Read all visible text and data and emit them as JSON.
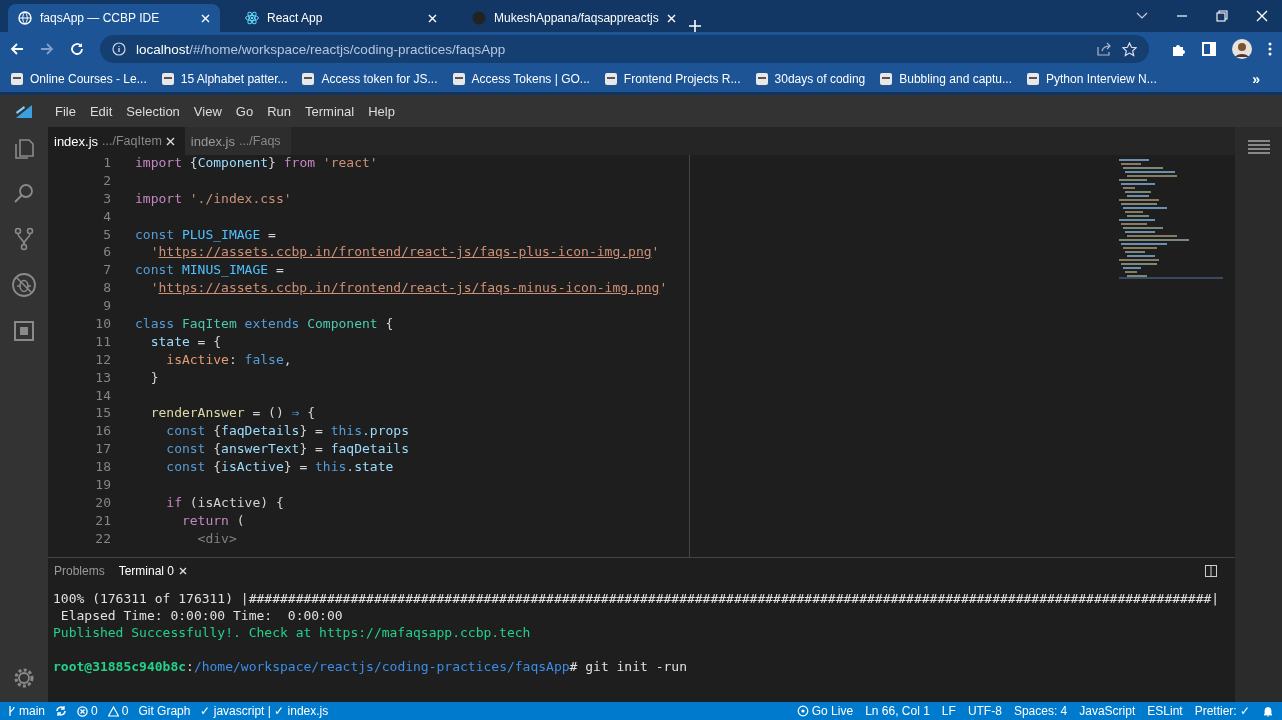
{
  "browser": {
    "tabs": [
      {
        "title": "faqsApp — CCBP IDE",
        "selected": true
      },
      {
        "title": "React App",
        "selected": false
      },
      {
        "title": "MukeshAppana/faqsappreactjs",
        "selected": false
      }
    ],
    "address": {
      "host": "localhost",
      "path": "/#/home/workspace/reactjs/coding-practices/faqsApp"
    },
    "bookmarks": [
      "Online Courses - Le...",
      "15 Alphabet patter...",
      "Access token for JS...",
      "Access Tokens | GO...",
      "Frontend Projects R...",
      "30days of coding",
      "Bubbling and captu...",
      "Python Interview N..."
    ],
    "bookmarks_more": "»"
  },
  "ide": {
    "menu": [
      "File",
      "Edit",
      "Selection",
      "View",
      "Go",
      "Run",
      "Terminal",
      "Help"
    ],
    "editor_tabs": [
      {
        "name": "index.js",
        "path": ".../FaqItem",
        "selected": true
      },
      {
        "name": "index.js",
        "path": ".../Faqs",
        "selected": false
      }
    ],
    "code": [
      {
        "number": "1",
        "tokens": [
          {
            "text": "import",
            "kind": "keyword"
          },
          {
            "text": " {",
            "kind": "plain"
          },
          {
            "text": "Component",
            "kind": "variable"
          },
          {
            "text": "} ",
            "kind": "plain"
          },
          {
            "text": "from",
            "kind": "keyword"
          },
          {
            "text": " 'react'",
            "kind": "string"
          }
        ]
      },
      {
        "number": "2"
      },
      {
        "number": "3",
        "tokens": [
          {
            "text": "import",
            "kind": "keyword"
          },
          {
            "text": " './index.css'",
            "kind": "string"
          }
        ]
      },
      {
        "number": "4"
      },
      {
        "number": "5",
        "tokens": [
          {
            "text": "const",
            "kind": "storage"
          },
          {
            "text": " PLUS_IMAGE",
            "kind": "constant"
          },
          {
            "text": " =",
            "kind": "plain"
          }
        ]
      },
      {
        "number": "6",
        "tokens": [
          {
            "text": "  '",
            "kind": "string"
          },
          {
            "text": "https://assets.ccbp.in/frontend/react-js/faqs-plus-icon-img.png",
            "kind": "url"
          },
          {
            "text": "'",
            "kind": "string"
          }
        ]
      },
      {
        "number": "7",
        "tokens": [
          {
            "text": "const",
            "kind": "storage"
          },
          {
            "text": " MINUS_IMAGE",
            "kind": "constant"
          },
          {
            "text": " =",
            "kind": "plain"
          }
        ]
      },
      {
        "number": "8",
        "tokens": [
          {
            "text": "  '",
            "kind": "string"
          },
          {
            "text": "https://assets.ccbp.in/frontend/react-js/faqs-minus-icon-img.png",
            "kind": "url"
          },
          {
            "text": "'",
            "kind": "string"
          }
        ]
      },
      {
        "number": "9"
      },
      {
        "number": "10",
        "tokens": [
          {
            "text": "class",
            "kind": "storage"
          },
          {
            "text": " FaqItem",
            "kind": "class"
          },
          {
            "text": " extends",
            "kind": "storage"
          },
          {
            "text": " Component",
            "kind": "class"
          },
          {
            "text": " {",
            "kind": "plain"
          }
        ]
      },
      {
        "number": "11",
        "tokens": [
          {
            "text": "  state",
            "kind": "variable"
          },
          {
            "text": " = {",
            "kind": "plain"
          }
        ]
      },
      {
        "number": "12",
        "tokens": [
          {
            "text": "    isActive",
            "kind": "key"
          },
          {
            "text": ": ",
            "kind": "plain"
          },
          {
            "text": "false",
            "kind": "storage"
          },
          {
            "text": ",",
            "kind": "plain"
          }
        ]
      },
      {
        "number": "13",
        "tokens": [
          {
            "text": "  }",
            "kind": "plain"
          }
        ]
      },
      {
        "number": "14"
      },
      {
        "number": "15",
        "tokens": [
          {
            "text": "  renderAnswer",
            "kind": "function"
          },
          {
            "text": " = () ",
            "kind": "plain"
          },
          {
            "text": "⇒",
            "kind": "storage"
          },
          {
            "text": " {",
            "kind": "plain"
          }
        ]
      },
      {
        "number": "16",
        "tokens": [
          {
            "text": "    const",
            "kind": "storage"
          },
          {
            "text": " {",
            "kind": "plain"
          },
          {
            "text": "faqDetails",
            "kind": "variable"
          },
          {
            "text": "} = ",
            "kind": "plain"
          },
          {
            "text": "this",
            "kind": "storage"
          },
          {
            "text": ".props",
            "kind": "variable"
          }
        ]
      },
      {
        "number": "17",
        "tokens": [
          {
            "text": "    const",
            "kind": "storage"
          },
          {
            "text": " {",
            "kind": "plain"
          },
          {
            "text": "answerText",
            "kind": "variable"
          },
          {
            "text": "} = ",
            "kind": "plain"
          },
          {
            "text": "faqDetails",
            "kind": "variable"
          }
        ]
      },
      {
        "number": "18",
        "tokens": [
          {
            "text": "    const",
            "kind": "storage"
          },
          {
            "text": " {",
            "kind": "plain"
          },
          {
            "text": "isActive",
            "kind": "variable"
          },
          {
            "text": "} = ",
            "kind": "plain"
          },
          {
            "text": "this",
            "kind": "storage"
          },
          {
            "text": ".state",
            "kind": "variable"
          }
        ]
      },
      {
        "number": "19"
      },
      {
        "number": "20",
        "tokens": [
          {
            "text": "    if",
            "kind": "keyword"
          },
          {
            "text": " (isActive) {",
            "kind": "plain"
          }
        ]
      },
      {
        "number": "21",
        "tokens": [
          {
            "text": "      return",
            "kind": "keyword"
          },
          {
            "text": " (",
            "kind": "plain"
          }
        ]
      },
      {
        "number": "22",
        "tokens": [
          {
            "text": "        <",
            "kind": "tag"
          },
          {
            "text": "div",
            "kind": "tag"
          },
          {
            "text": ">",
            "kind": "tag"
          }
        ]
      }
    ],
    "panel_tabs": [
      {
        "label": "Problems",
        "selected": false
      },
      {
        "label": "Terminal 0",
        "selected": true
      }
    ],
    "terminal": [
      {
        "segments": [
          {
            "text": "100% (176311 of 176311) |###########################################################################################################################|",
            "kind": "plain"
          }
        ]
      },
      {
        "segments": [
          {
            "text": " Elapsed Time: 0:00:00 Time:  0:00:00",
            "kind": "plain"
          }
        ]
      },
      {
        "segments": [
          {
            "text": "Published Successfully!. Check at https://mafaqsapp.ccbp.tech",
            "kind": "success"
          }
        ]
      },
      {
        "segments": [
          {
            "text": "root@31885c940b8c",
            "kind": "user"
          },
          {
            "text": ":",
            "kind": "plain"
          },
          {
            "text": "/home/workspace/reactjs/coding-practices/faqsApp",
            "kind": "path"
          },
          {
            "text": "# git init -run",
            "kind": "plain"
          }
        ]
      }
    ],
    "status_left": [
      {
        "kind": "branch",
        "text": "main"
      },
      {
        "kind": "sync"
      },
      {
        "kind": "errors",
        "text": "0"
      },
      {
        "kind": "warnings",
        "text": "0"
      },
      {
        "kind": "text",
        "text": "Git Graph"
      },
      {
        "kind": "text",
        "text": "✓ javascript | ✓ index.js"
      }
    ],
    "status_right": [
      {
        "kind": "live",
        "text": "Go Live"
      },
      {
        "kind": "text",
        "text": "Ln 66, Col 1"
      },
      {
        "kind": "text",
        "text": "LF"
      },
      {
        "kind": "text",
        "text": "UTF-8"
      },
      {
        "kind": "text",
        "text": "Spaces: 4"
      },
      {
        "kind": "text",
        "text": "JavaScript"
      },
      {
        "kind": "text",
        "text": "ESLint"
      },
      {
        "kind": "text",
        "text": "Prettier: ✓"
      },
      {
        "kind": "bell"
      }
    ]
  }
}
